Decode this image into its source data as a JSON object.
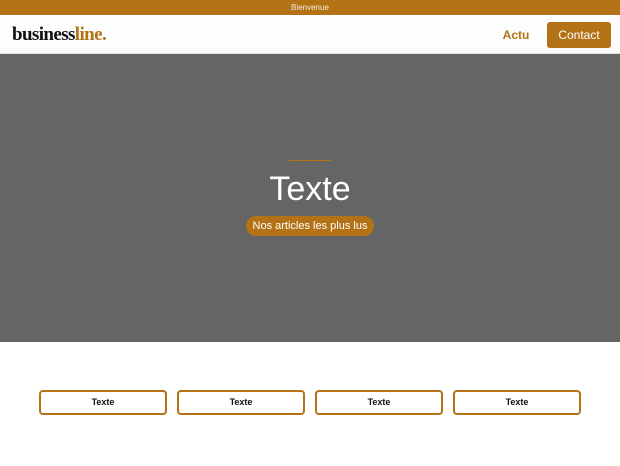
{
  "topbar": {
    "text": "Bienvenue"
  },
  "header": {
    "logo_main": "business",
    "logo_accent": "line.",
    "nav_actu": "Actu",
    "nav_contact": "Contact"
  },
  "hero": {
    "title": "Texte",
    "button_label": "Nos articles les plus lus"
  },
  "cards": [
    {
      "label": "Texte"
    },
    {
      "label": "Texte"
    },
    {
      "label": "Texte"
    },
    {
      "label": "Texte"
    }
  ],
  "colors": {
    "accent": "#b47216",
    "hero_bg": "#656565"
  }
}
